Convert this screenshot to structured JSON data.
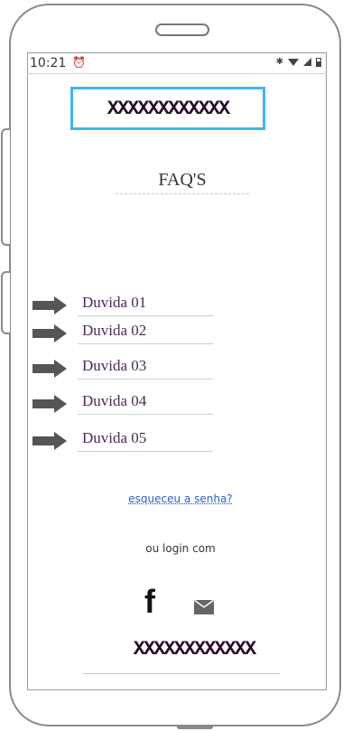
{
  "status_bar": {
    "time": "10:21",
    "alarm_icon": "alarm-icon",
    "icons": [
      "bluetooth-icon",
      "wifi-icon",
      "signal-icon",
      "battery-icon"
    ]
  },
  "header": {
    "logo_text": "XXXXXXXXXXXX"
  },
  "faq": {
    "title": "FAQ'S",
    "items": [
      {
        "label": "Duvida 01"
      },
      {
        "label": "Duvida 02"
      },
      {
        "label": "Duvida 03"
      },
      {
        "label": "Duvida 04"
      },
      {
        "label": "Duvida 05"
      }
    ]
  },
  "auth": {
    "forgot_password": "esqueceu a senha?",
    "login_with": "ou login com",
    "facebook_glyph": "f"
  },
  "footer": {
    "text": "XXXXXXXXXXXX"
  },
  "colors": {
    "logo_border": "#3fb6ee",
    "link": "#2a5fd6",
    "faq_text": "#4a2a5a"
  }
}
